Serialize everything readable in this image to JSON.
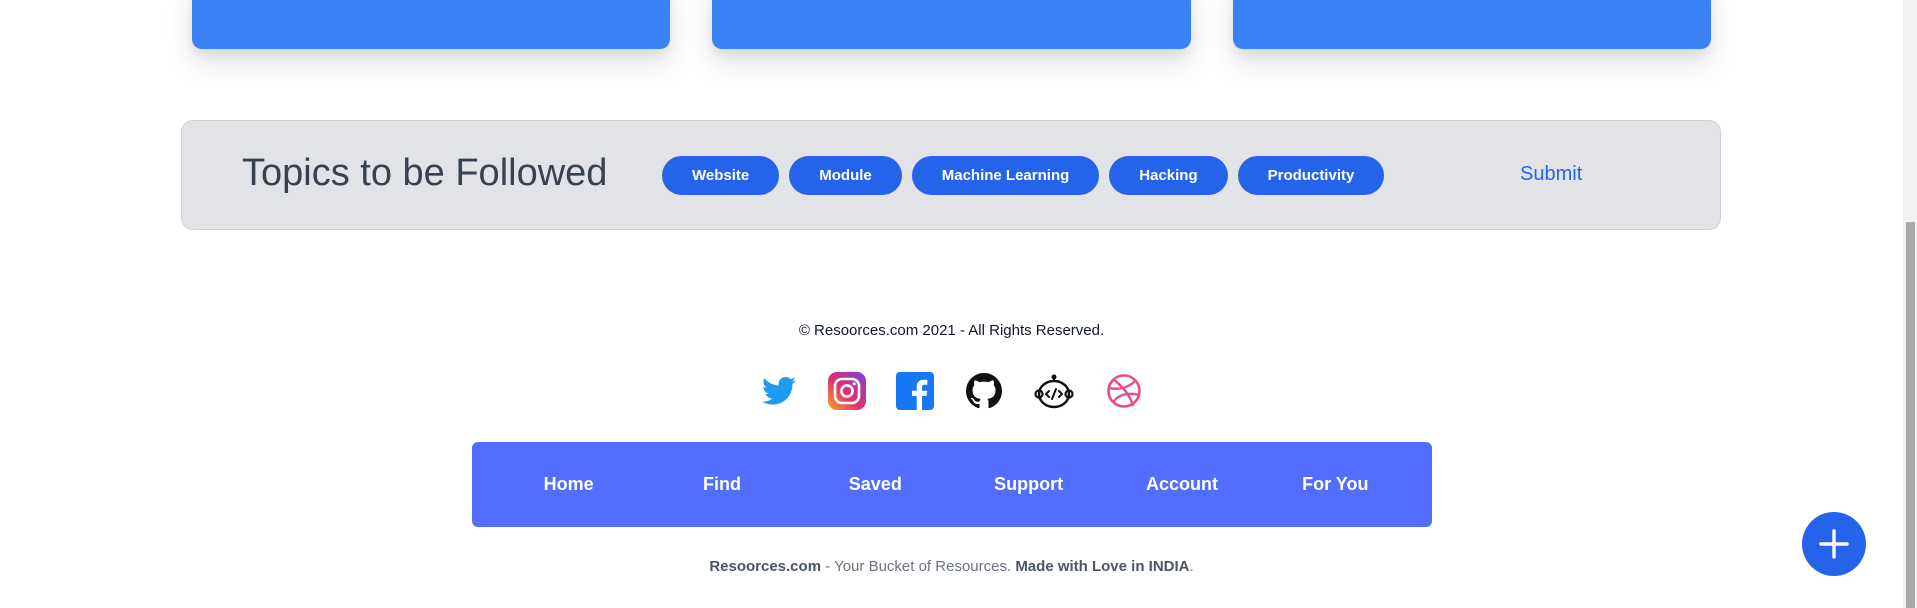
{
  "topics": {
    "title": "Topics to be Followed",
    "chips": [
      "Website",
      "Module",
      "Machine Learning",
      "Hacking",
      "Productivity"
    ],
    "submit_label": "Submit"
  },
  "footer": {
    "copyright": "© Resoorces.com 2021 - All Rights Reserved.",
    "social_icons": [
      "twitter-icon",
      "instagram-icon",
      "facebook-icon",
      "github-icon",
      "dev-icon",
      "dribbble-icon"
    ],
    "nav": [
      "Home",
      "Find",
      "Saved",
      "Support",
      "Account",
      "For You"
    ],
    "tagline": {
      "brand": "Resoorces.com",
      "middle": " - Your Bucket of Resources. ",
      "love": "Made with Love in INDIA",
      "end": "."
    }
  },
  "colors": {
    "accent": "#2563eb",
    "card": "#3b82f6",
    "navbar": "#536dfe",
    "topics_bg": "#e2e3e6"
  }
}
